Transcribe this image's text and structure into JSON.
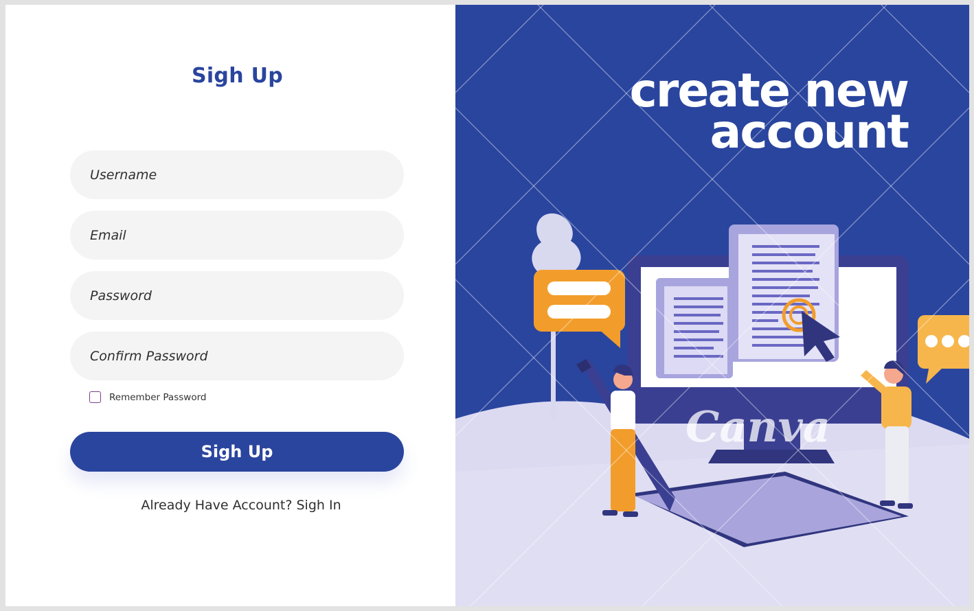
{
  "form": {
    "title": "Sigh Up",
    "fields": {
      "username_placeholder": "Username",
      "email_placeholder": "Email",
      "password_placeholder": "Password",
      "confirm_password_placeholder": "Confirm Password"
    },
    "remember_label": "Remember Password",
    "remember_checked": false,
    "submit_label": "Sigh Up",
    "signin_prompt": "Already Have Account? Sigh In"
  },
  "hero": {
    "headline_line1": "create new",
    "headline_line2": "account",
    "watermark": "Canva"
  },
  "colors": {
    "primary": "#2a459e",
    "field_bg": "#f4f4f4",
    "accent_orange": "#f29d2b",
    "lavender": "#dcdaf1",
    "checkbox_border": "#7a3d8a"
  }
}
